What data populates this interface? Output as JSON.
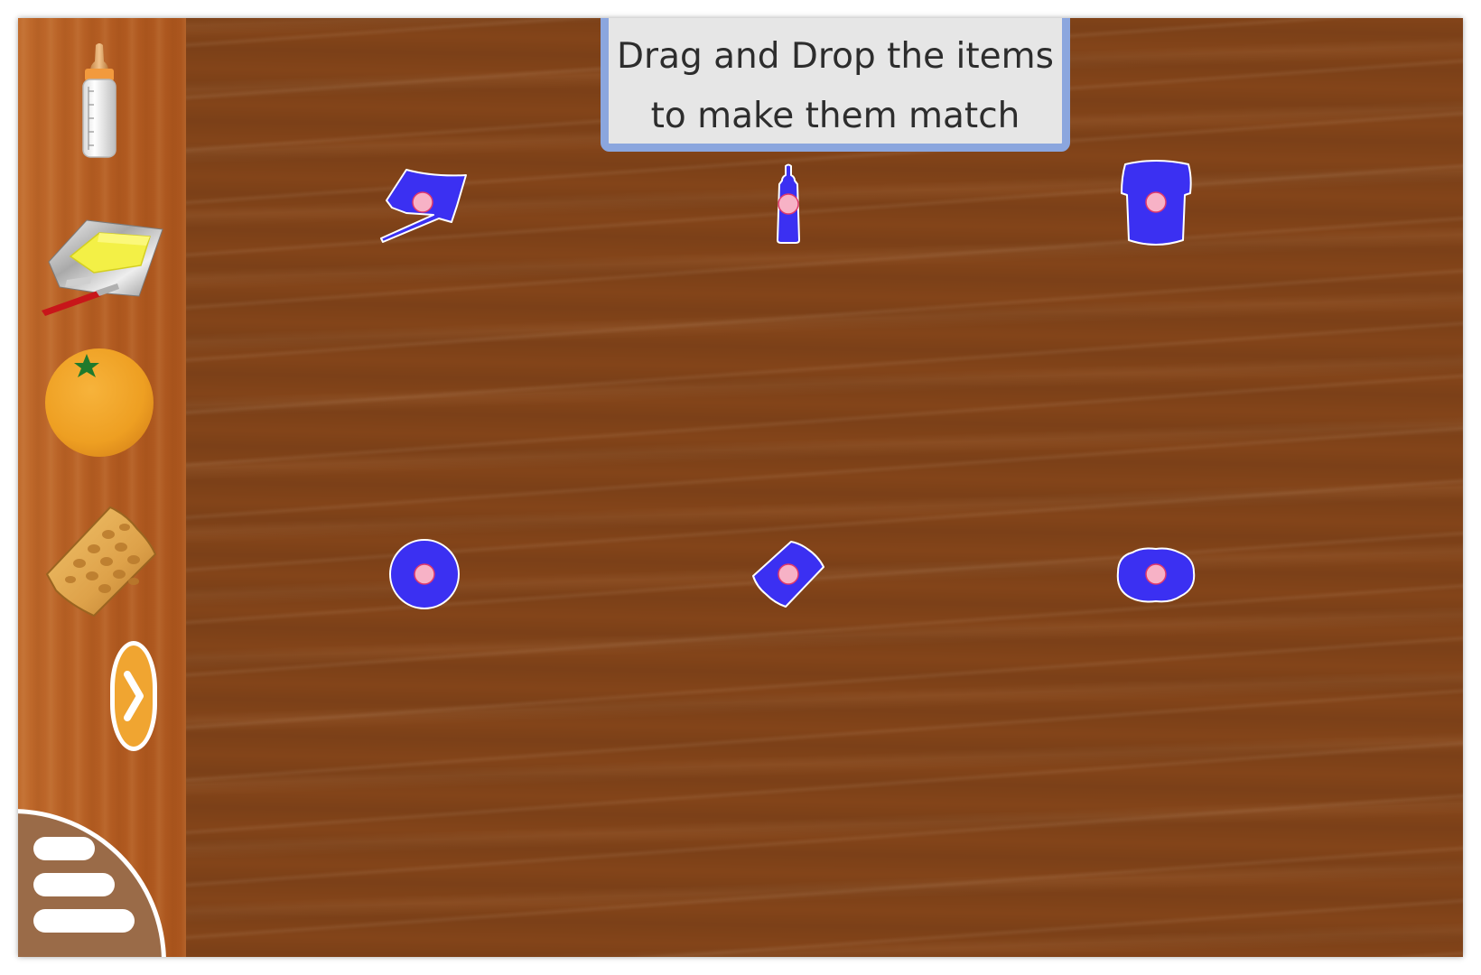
{
  "instruction": {
    "line1": "Drag and Drop the items",
    "line2": "to make them match"
  },
  "sidebar": {
    "items": [
      {
        "icon": "baby-bottle-icon"
      },
      {
        "icon": "butter-icon"
      },
      {
        "icon": "orange-icon"
      },
      {
        "icon": "waffle-icon"
      }
    ],
    "next_icon": "chevron-right-icon",
    "menu_icon": "hamburger-menu-icon"
  },
  "targets": [
    {
      "shape": "butter-silhouette"
    },
    {
      "shape": "bottle-silhouette"
    },
    {
      "shape": "cup-silhouette"
    },
    {
      "shape": "orange-silhouette"
    },
    {
      "shape": "waffle-silhouette"
    },
    {
      "shape": "splat-silhouette"
    }
  ],
  "colors": {
    "silhouette": "#3b30f2",
    "drop_dot": "#f7b2c6",
    "table": "#834419",
    "sidebar": "#b65f24",
    "instruction_border": "#8ba6de",
    "next_button": "#f0a531"
  }
}
